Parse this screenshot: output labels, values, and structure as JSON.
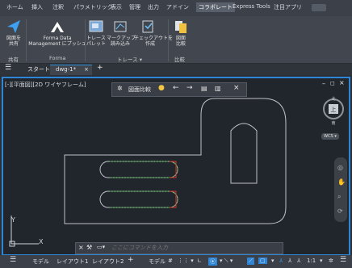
{
  "ribbon_tabs": [
    "ホーム",
    "挿入",
    "注釈",
    "パラメトリック",
    "表示",
    "管理",
    "出力",
    "アドイン",
    "コラボレート",
    "Express Tools",
    "注目アプリ"
  ],
  "active_tab_index": 8,
  "ribbon": {
    "share_button": "図面を\n共有",
    "forma_button": "Forma Data\nManagement にプッシュ",
    "trace_palette": "トレース\nパレット",
    "markup_import": "マークアップ\n読み込み",
    "checkout_create": "チェックアウトを\n作成",
    "drawing_compare": "図面\n比較",
    "groups": {
      "share": "共有",
      "forma": "Forma",
      "trace": "トレース ▾",
      "compare": "比較"
    }
  },
  "file_tabs": {
    "start": "スタート",
    "drawing": "dwg-1*"
  },
  "viewport": {
    "label": "[-][平面図][2D ワイヤフレーム]",
    "compare_toolbar_title": "図面比較",
    "viewcube_top": "上",
    "compass_n": "北",
    "compass_s": "南",
    "wcs": "WCS ▾"
  },
  "command": {
    "placeholder": "ここにコマンドを入力"
  },
  "status": {
    "model_tab": "モデル",
    "layout1": "レイアウト1",
    "layout2": "レイアウト2",
    "model_btn": "モデル",
    "scale": "1:1"
  },
  "colors": {
    "accent": "#2f86d6",
    "added": "#3fb43a",
    "removed": "#e03030"
  }
}
